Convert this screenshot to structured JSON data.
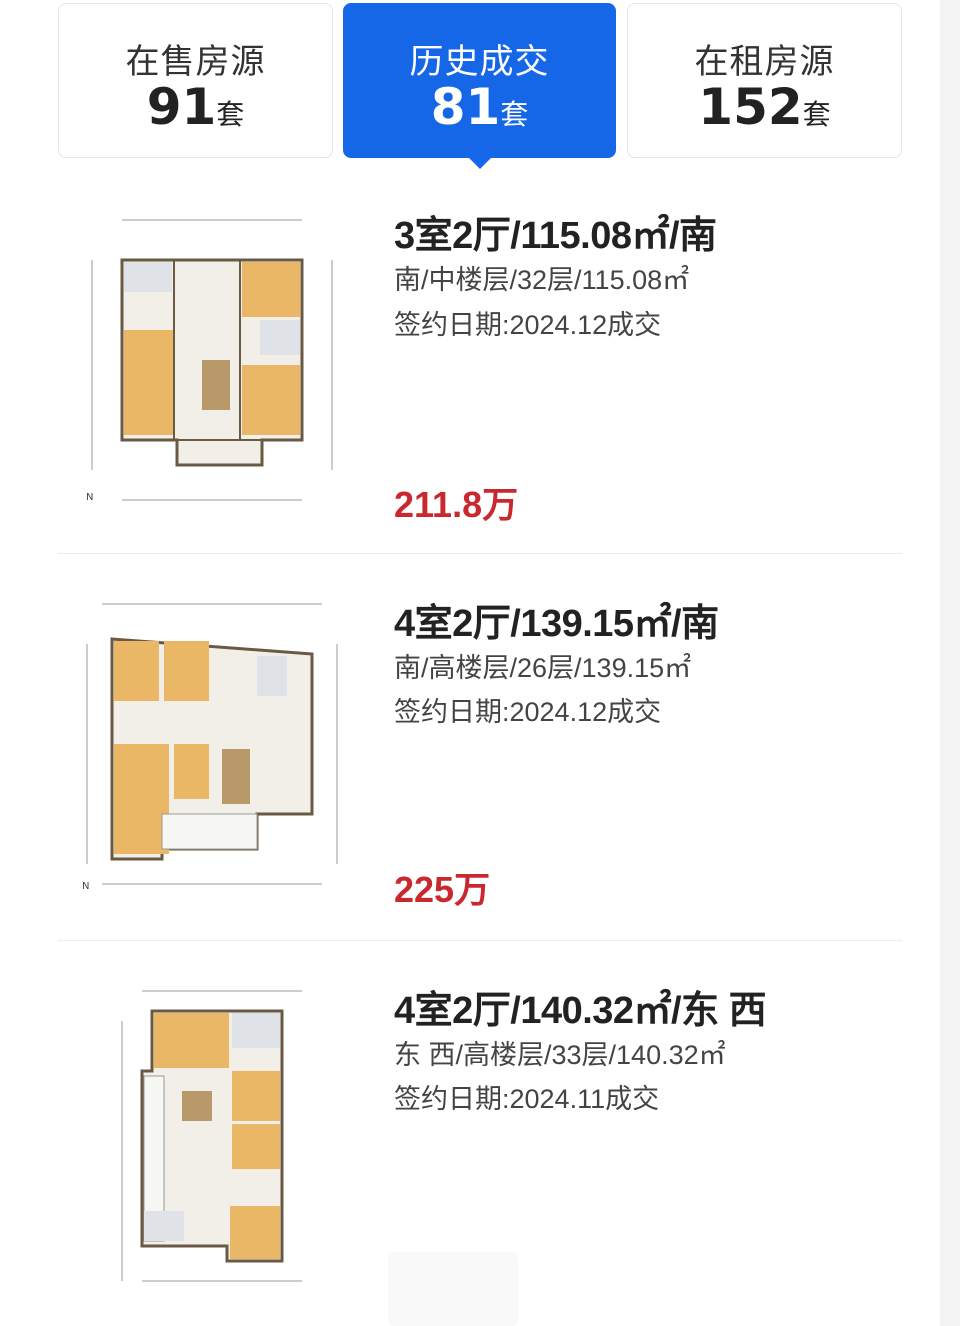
{
  "tabs": [
    {
      "label": "在售房源",
      "count": "91",
      "unit": "套",
      "active": false
    },
    {
      "label": "历史成交",
      "count": "81",
      "unit": "套",
      "active": true
    },
    {
      "label": "在租房源",
      "count": "152",
      "unit": "套",
      "active": false
    }
  ],
  "listings": [
    {
      "title": "3室2厅/115.08㎡/南",
      "detail": "南/中楼层/32层/115.08㎡",
      "sign_date": "签约日期:2024.12成交",
      "price": "211.8万"
    },
    {
      "title": "4室2厅/139.15㎡/南",
      "detail": "南/高楼层/26层/139.15㎡",
      "sign_date": "签约日期:2024.12成交",
      "price": "225万"
    },
    {
      "title": "4室2厅/140.32㎡/东 西",
      "detail": "东 西/高楼层/33层/140.32㎡",
      "sign_date": "签约日期:2024.11成交",
      "price": ""
    }
  ],
  "colors": {
    "accent": "#1667e8",
    "price": "#c8282e",
    "room_fill": "#e9b765"
  }
}
